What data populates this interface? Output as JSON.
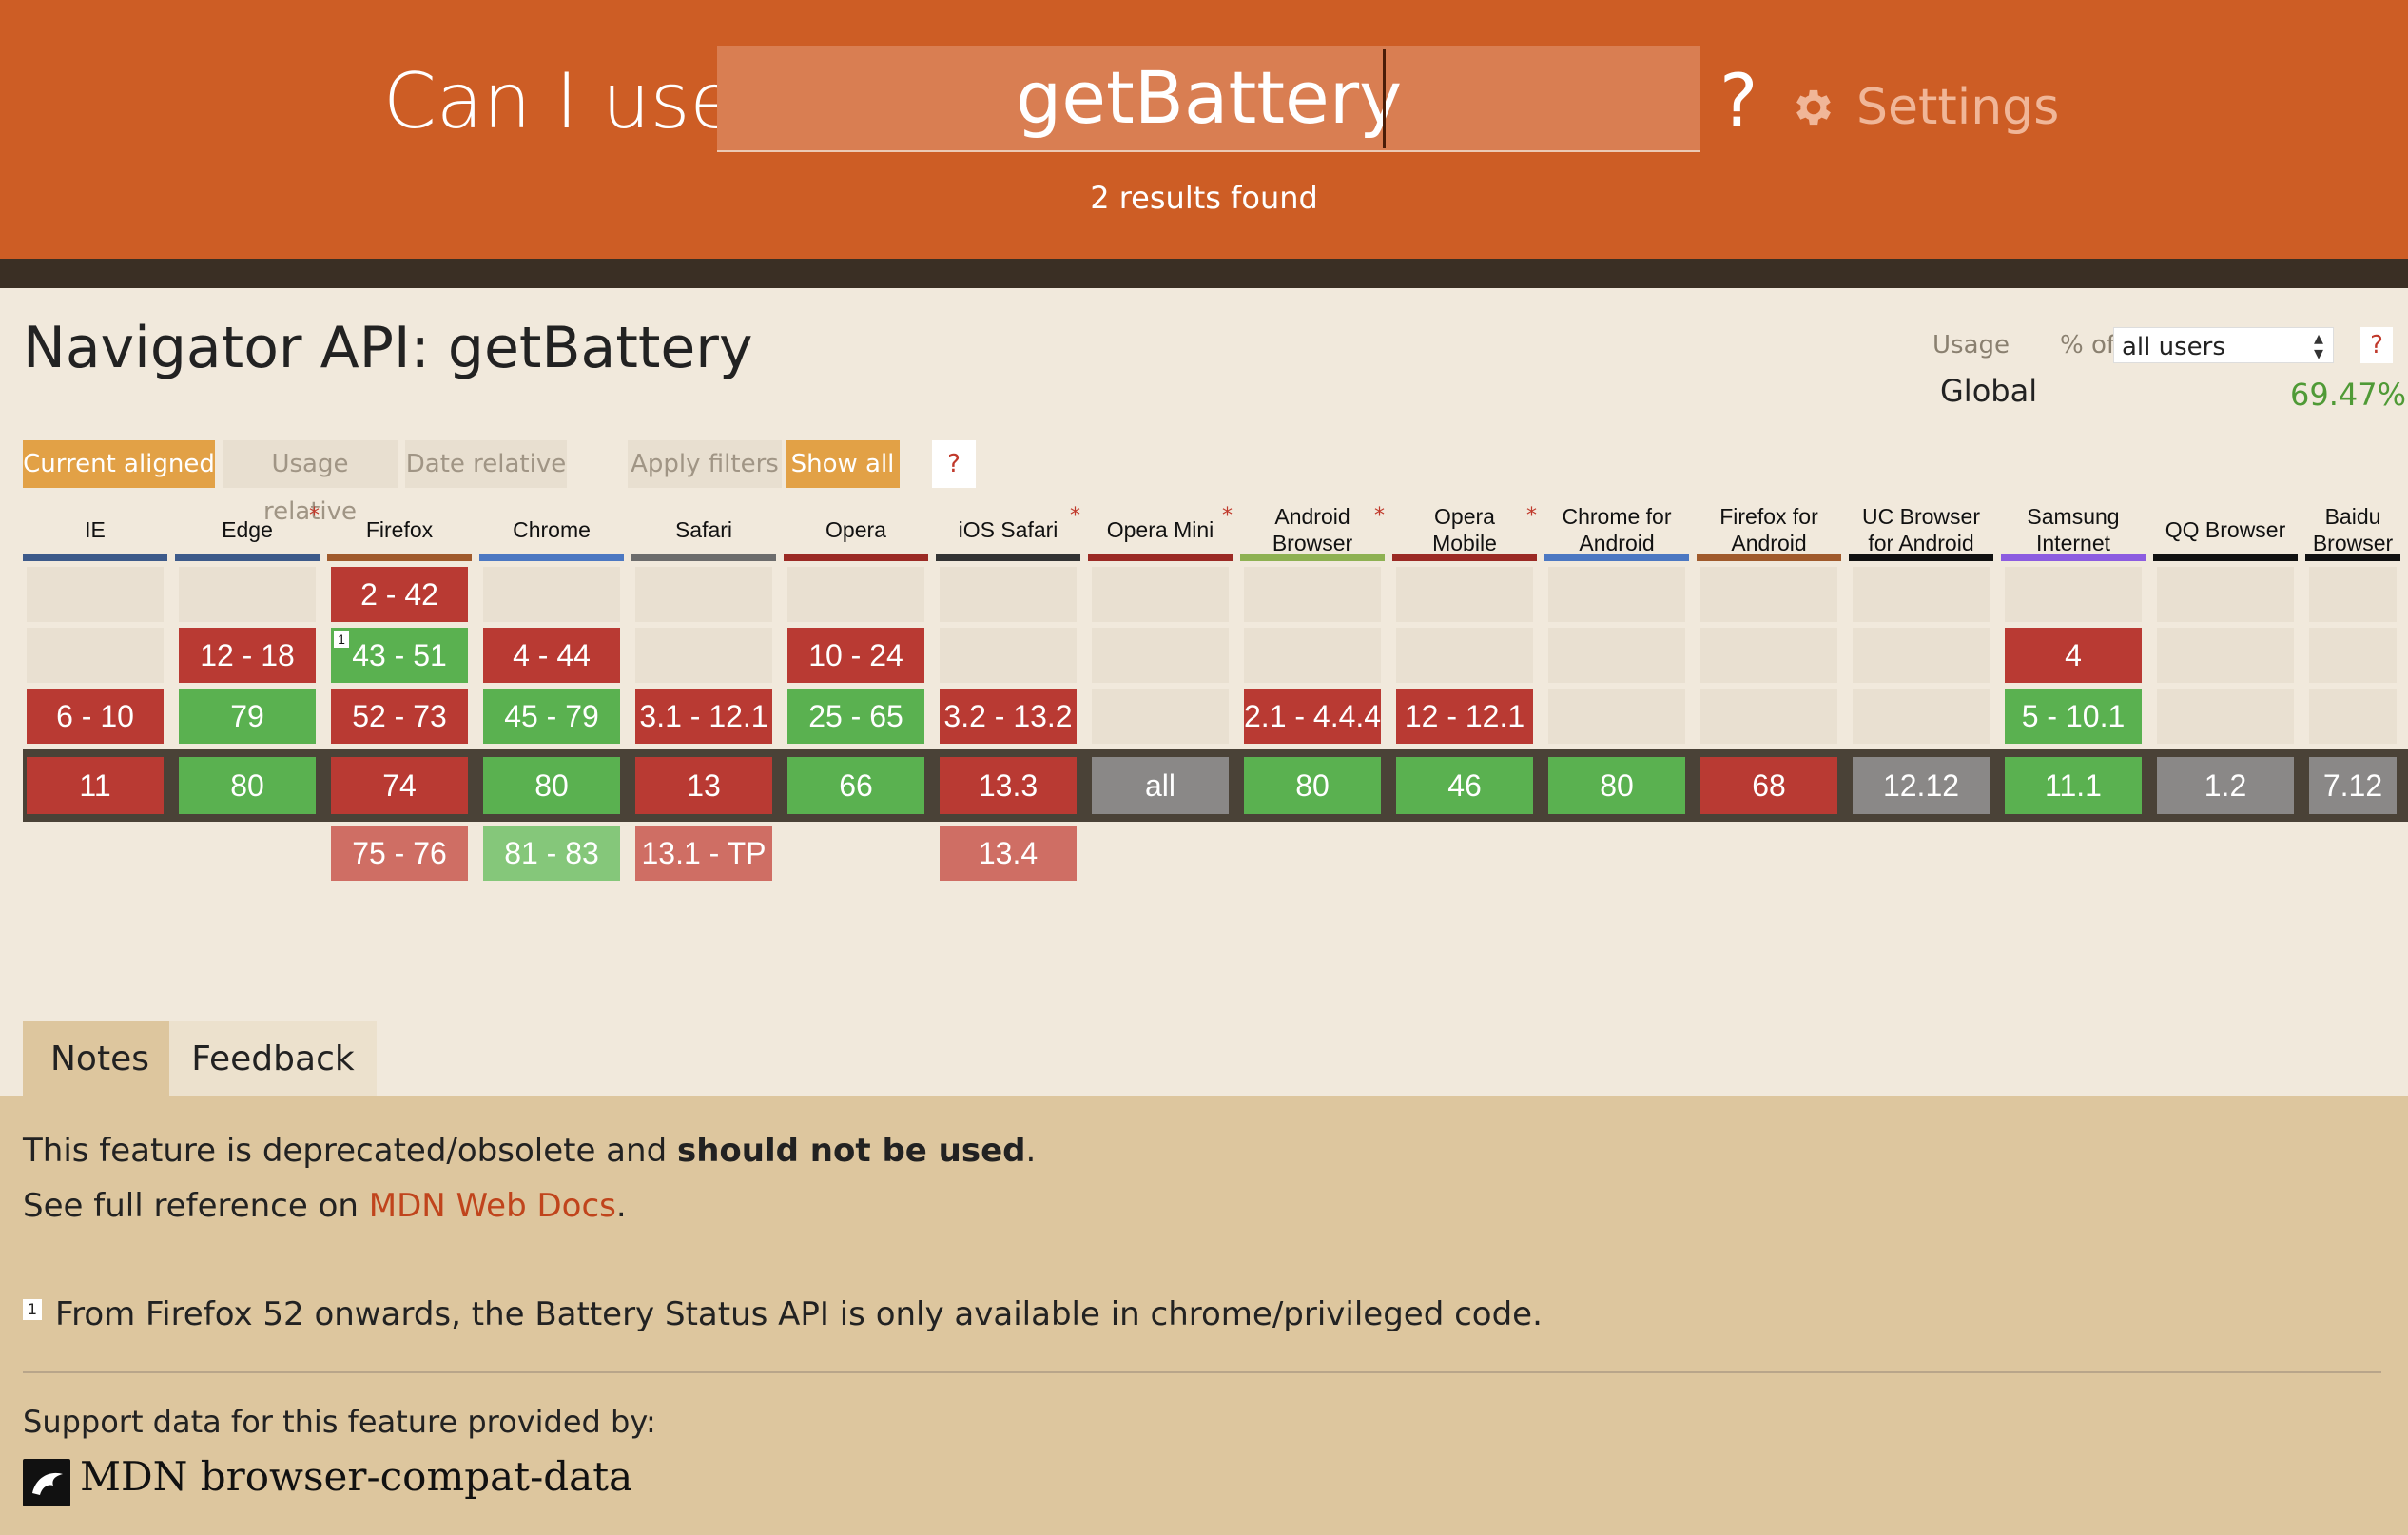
{
  "header": {
    "brand": "Can I use",
    "search_value": "getBattery",
    "help": "?",
    "settings_label": "Settings",
    "results": "2 results found"
  },
  "feature": {
    "title": "Navigator API: getBattery",
    "usage_label": "Usage",
    "pct_of": "% of",
    "users_select": "all users",
    "usage_help": "?",
    "global_label": "Global",
    "global_value": "69.47%"
  },
  "filters": {
    "current_aligned": "Current aligned",
    "usage_relative": "Usage relative",
    "date_relative": "Date relative",
    "apply_filters": "Apply filters",
    "show_all": "Show all",
    "help": "?"
  },
  "browsers": [
    {
      "name": "IE",
      "bar": "#3d5a8a",
      "star": "",
      "cells": [
        null,
        null,
        {
          "t": "n",
          "v": "6 - 10"
        },
        {
          "t": "n",
          "v": "11"
        },
        null
      ]
    },
    {
      "name": "Edge",
      "bar": "#3d5a8a",
      "star": "*",
      "cells": [
        null,
        {
          "t": "n",
          "v": "12 - 18"
        },
        {
          "t": "y",
          "v": "79"
        },
        {
          "t": "y",
          "v": "80"
        },
        null
      ]
    },
    {
      "name": "Firefox",
      "bar": "#a05a2c",
      "star": "",
      "cells": [
        {
          "t": "n",
          "v": "2 - 42"
        },
        {
          "t": "y",
          "v": "43 - 51",
          "note": "1"
        },
        {
          "t": "n",
          "v": "52 - 73"
        },
        {
          "t": "n",
          "v": "74"
        },
        {
          "t": "fn",
          "v": "75 - 76"
        }
      ]
    },
    {
      "name": "Chrome",
      "bar": "#4c78c2",
      "star": "",
      "cells": [
        null,
        {
          "t": "n",
          "v": "4 - 44"
        },
        {
          "t": "y",
          "v": "45 - 79"
        },
        {
          "t": "y",
          "v": "80"
        },
        {
          "t": "fy",
          "v": "81 - 83"
        }
      ]
    },
    {
      "name": "Safari",
      "bar": "#6c6c6c",
      "star": "",
      "cells": [
        null,
        null,
        {
          "t": "n",
          "v": "3.1 - 12.1"
        },
        {
          "t": "n",
          "v": "13"
        },
        {
          "t": "fn",
          "v": "13.1 - TP"
        }
      ]
    },
    {
      "name": "Opera",
      "bar": "#9b2a24",
      "star": "",
      "cells": [
        null,
        {
          "t": "n",
          "v": "10 - 24"
        },
        {
          "t": "y",
          "v": "25 - 65"
        },
        {
          "t": "y",
          "v": "66"
        },
        null
      ]
    },
    {
      "name": "iOS Safari",
      "bar": "#333333",
      "star": "*",
      "cells": [
        null,
        null,
        {
          "t": "n",
          "v": "3.2 - 13.2"
        },
        {
          "t": "n",
          "v": "13.3"
        },
        {
          "t": "fn",
          "v": "13.4"
        }
      ]
    },
    {
      "name": "Opera Mini",
      "bar": "#9b2a24",
      "star": "*",
      "cells": [
        null,
        null,
        null,
        {
          "t": "u",
          "v": "all"
        },
        null
      ]
    },
    {
      "name": "Android Browser",
      "bar": "#8eb152",
      "star": "*",
      "cells": [
        null,
        null,
        {
          "t": "n",
          "v": "2.1 - 4.4.4"
        },
        {
          "t": "y",
          "v": "80"
        },
        null
      ]
    },
    {
      "name": "Opera Mobile",
      "bar": "#9b2a24",
      "star": "*",
      "cells": [
        null,
        null,
        {
          "t": "n",
          "v": "12 - 12.1"
        },
        {
          "t": "y",
          "v": "46"
        },
        null
      ]
    },
    {
      "name": "Chrome for Android",
      "bar": "#4c78c2",
      "star": "",
      "cells": [
        null,
        null,
        null,
        {
          "t": "y",
          "v": "80"
        },
        null
      ]
    },
    {
      "name": "Firefox for Android",
      "bar": "#a05a2c",
      "star": "",
      "cells": [
        null,
        null,
        null,
        {
          "t": "n",
          "v": "68"
        },
        null
      ]
    },
    {
      "name": "UC Browser for Android",
      "bar": "#111111",
      "star": "",
      "cells": [
        null,
        null,
        null,
        {
          "t": "u",
          "v": "12.12"
        },
        null
      ]
    },
    {
      "name": "Samsung Internet",
      "bar": "#8c5ce0",
      "star": "",
      "cells": [
        null,
        {
          "t": "n",
          "v": "4"
        },
        {
          "t": "y",
          "v": "5 - 10.1"
        },
        {
          "t": "y",
          "v": "11.1"
        },
        null
      ]
    },
    {
      "name": "QQ Browser",
      "bar": "#111111",
      "star": "",
      "cells": [
        null,
        null,
        null,
        {
          "t": "u",
          "v": "1.2"
        },
        null
      ]
    },
    {
      "name": "Baidu Browser",
      "bar": "#111111",
      "star": "",
      "cells": [
        null,
        null,
        null,
        {
          "t": "u",
          "v": "7.12"
        },
        null
      ]
    }
  ],
  "tabs": {
    "notes": "Notes",
    "feedback": "Feedback"
  },
  "notes": {
    "line1_pre": "This feature is deprecated/obsolete and ",
    "line1_bold": "should not be used",
    "line1_post": ".",
    "line2_pre": "See full reference on ",
    "line2_link": "MDN Web Docs",
    "line2_post": ".",
    "footnote_marker": "1",
    "footnote_text": "From Firefox 52 onwards, the Battery Status API is only available in chrome/privileged code.",
    "support_label": "Support data for this feature provided by:",
    "mdn_label": "MDN browser-compat-data"
  }
}
